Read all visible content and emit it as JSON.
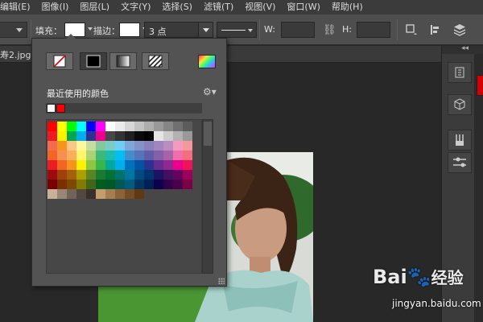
{
  "menu": {
    "items": [
      "编辑(E)",
      "图像(I)",
      "图层(L)",
      "文字(Y)",
      "选择(S)",
      "滤镜(T)",
      "视图(V)",
      "窗口(W)",
      "帮助(H)"
    ]
  },
  "options_bar": {
    "fill_label": "填充：",
    "stroke_label": "描边：",
    "stroke_size": "3 点",
    "width_label": "W:",
    "height_label": "H:"
  },
  "document": {
    "tab_label": "寿2.jpg @"
  },
  "fill_popup": {
    "recent_title": "最近使用的颜色",
    "recent_colors": [
      "#ffffff",
      "#ff0000"
    ],
    "swatch_rows": [
      [
        "#ff0000",
        "#ffff00",
        "#00ff00",
        "#00ffff",
        "#0000ff",
        "#ff00ff",
        "#ffffff",
        "#ebebeb",
        "#d6d6d6",
        "#c2c2c2",
        "#adadad",
        "#999999",
        "#858585",
        "#707070",
        "#5c5c5c"
      ],
      [
        "#ed1c24",
        "#fff200",
        "#00a651",
        "#00aeef",
        "#2e3192",
        "#ec008c",
        "#474747",
        "#333333",
        "#1f1f1f",
        "#0a0a0a",
        "#000000",
        "#e5e5e5",
        "#cccccc",
        "#b2b2b2",
        "#999999"
      ],
      [
        "#f26c4f",
        "#f7941d",
        "#fdc689",
        "#fff799",
        "#c4df9b",
        "#82ca9c",
        "#7accc8",
        "#6dcff6",
        "#7da7d9",
        "#8393ca",
        "#8781bd",
        "#a186be",
        "#bd8cbf",
        "#f49ac1",
        "#f5989d"
      ],
      [
        "#f26522",
        "#f68e56",
        "#fbaf5d",
        "#fff568",
        "#acd373",
        "#3cb878",
        "#1cbbb4",
        "#00bff3",
        "#448ccb",
        "#5574b9",
        "#605ca8",
        "#855fa8",
        "#a763a8",
        "#f06eaa",
        "#f26d7d"
      ],
      [
        "#ed1c24",
        "#f26522",
        "#f7941d",
        "#fff200",
        "#8dc63f",
        "#39b54a",
        "#00a99d",
        "#00aeef",
        "#0072bc",
        "#0054a6",
        "#2e3192",
        "#662d91",
        "#92278f",
        "#ec008c",
        "#ed145b"
      ],
      [
        "#9e0b0f",
        "#a0410d",
        "#a36209",
        "#aba000",
        "#598527",
        "#1a7b30",
        "#007236",
        "#00746b",
        "#0076a3",
        "#004a80",
        "#003471",
        "#1b1464",
        "#440e62",
        "#630460",
        "#9e005d"
      ],
      [
        "#790000",
        "#7b2e00",
        "#7d4900",
        "#827b00",
        "#406618",
        "#005e20",
        "#005826",
        "#005952",
        "#005b7f",
        "#003663",
        "#002157",
        "#0d004c",
        "#32004b",
        "#4b0049",
        "#7b0046"
      ],
      [
        "#c7b299",
        "#998675",
        "#736357",
        "#534741",
        "#37302d",
        "#c69c6d",
        "#a67c52",
        "#8c6239",
        "#754c24",
        "#603913"
      ]
    ]
  },
  "watermark": {
    "logo_text": "Bai",
    "logo_suffix": "经验",
    "url": "jingyan.baidu.com"
  }
}
